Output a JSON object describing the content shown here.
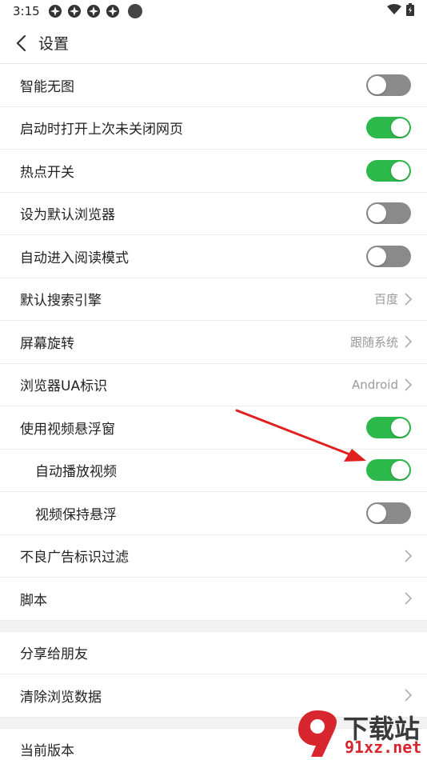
{
  "status": {
    "time": "3:15"
  },
  "header": {
    "title": "设置"
  },
  "rows": [
    {
      "label": "智能无图",
      "toggle": false
    },
    {
      "label": "启动时打开上次未关闭网页",
      "toggle": true
    },
    {
      "label": "热点开关",
      "toggle": true
    },
    {
      "label": "设为默认浏览器",
      "toggle": false
    },
    {
      "label": "自动进入阅读模式",
      "toggle": false
    },
    {
      "label": "默认搜索引擎",
      "value": "百度"
    },
    {
      "label": "屏幕旋转",
      "value": "跟随系统"
    },
    {
      "label": "浏览器UA标识",
      "value": "Android"
    },
    {
      "label": "使用视频悬浮窗",
      "toggle": true
    },
    {
      "label": "自动播放视频",
      "toggle": true
    },
    {
      "label": "视频保持悬浮",
      "toggle": false
    },
    {
      "label": "不良广告标识过滤"
    },
    {
      "label": "脚本"
    },
    {
      "label": "分享给朋友"
    },
    {
      "label": "清除浏览数据"
    },
    {
      "label": "当前版本"
    }
  ],
  "colors": {
    "toggle_on": "#2db84b",
    "toggle_off": "#8a8a8a",
    "arrow": "#e02020"
  },
  "watermark": {
    "line1": "下载站",
    "line2": "91xz.net"
  }
}
